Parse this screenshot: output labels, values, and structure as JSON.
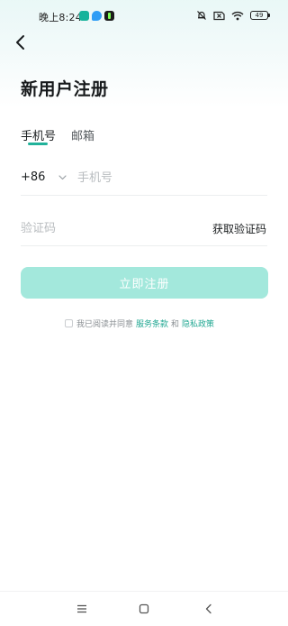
{
  "status_bar": {
    "time": "晚上8:24",
    "battery": "49",
    "icons": [
      "teal-app-icon",
      "blue-app-icon",
      "dark-app-icon",
      "muted-bell-icon",
      "no-sim-icon",
      "wifi-icon",
      "battery-icon"
    ]
  },
  "header": {
    "title": "新用户注册",
    "back_icon": "back-arrow-icon"
  },
  "tabs": [
    {
      "label": "手机号",
      "selected": true
    },
    {
      "label": "邮箱",
      "selected": false
    }
  ],
  "phone": {
    "country_code": "+86",
    "placeholder": "手机号",
    "value": ""
  },
  "verification": {
    "placeholder": "验证码",
    "value": "",
    "get_code_label": "获取验证码"
  },
  "register_button": {
    "label": "立即注册",
    "enabled": false
  },
  "agreement": {
    "checked": false,
    "prefix": "我已阅读并同意",
    "terms_link": "服务条款",
    "conjunction": "和",
    "privacy_link": "隐私政策"
  },
  "navigation_bar": {
    "icons": [
      "menu-icon",
      "home-icon",
      "back-icon"
    ]
  },
  "colors": {
    "accent": "#21b29a",
    "button_disabled": "#a3e8dc",
    "link": "#23a893"
  }
}
